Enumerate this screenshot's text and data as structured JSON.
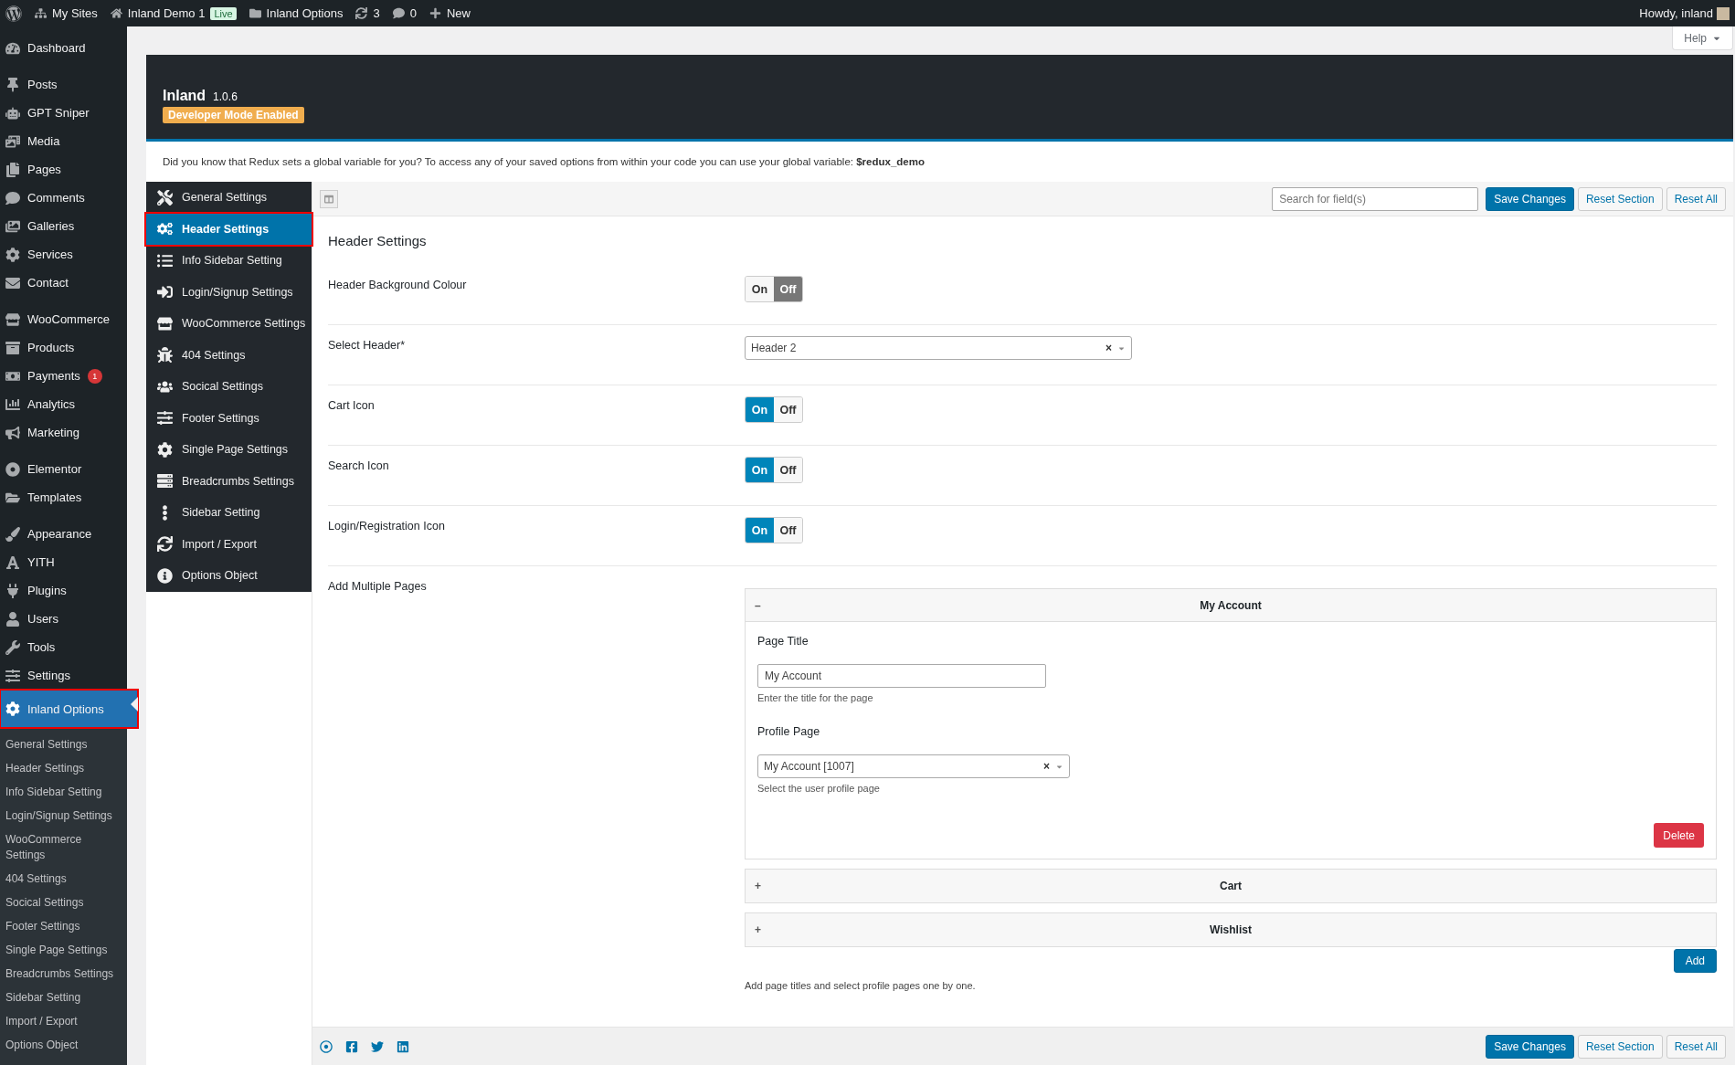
{
  "admin_bar": {
    "items": [
      {
        "kind": "link",
        "label": "My Sites"
      },
      {
        "kind": "link",
        "label": "Inland Demo 1"
      },
      {
        "kind": "badge",
        "label": "Live"
      },
      {
        "kind": "link",
        "label": "Inland Options"
      },
      {
        "kind": "count",
        "label": "3"
      },
      {
        "kind": "count",
        "label": "0"
      },
      {
        "kind": "link",
        "label": "New"
      }
    ],
    "greeting": "Howdy, inland"
  },
  "sidebar": {
    "groups": [
      {
        "items": [
          {
            "label": "Dashboard",
            "selected": false
          }
        ]
      },
      {
        "items": [
          {
            "label": "Posts",
            "selected": false
          },
          {
            "label": "GPT Sniper",
            "selected": false
          },
          {
            "label": "Media",
            "selected": false
          },
          {
            "label": "Pages",
            "selected": false
          },
          {
            "label": "Comments",
            "selected": false
          },
          {
            "label": "Galleries",
            "selected": false
          },
          {
            "label": "Services",
            "selected": false
          },
          {
            "label": "Contact",
            "selected": false
          }
        ]
      },
      {
        "items": [
          {
            "label": "WooCommerce",
            "selected": false
          },
          {
            "label": "Products",
            "selected": false
          },
          {
            "label": "Payments",
            "selected": false,
            "badge": "1"
          },
          {
            "label": "Analytics",
            "selected": false
          },
          {
            "label": "Marketing",
            "selected": false
          }
        ]
      },
      {
        "items": [
          {
            "label": "Elementor",
            "selected": false
          },
          {
            "label": "Templates",
            "selected": false
          }
        ]
      },
      {
        "items": [
          {
            "label": "Appearance",
            "selected": false
          },
          {
            "label": "YITH",
            "selected": false
          },
          {
            "label": "Plugins",
            "selected": false
          },
          {
            "label": "Users",
            "selected": false
          },
          {
            "label": "Tools",
            "selected": false
          },
          {
            "label": "Settings",
            "selected": false
          },
          {
            "label": "Inland Options",
            "selected": true,
            "annotated": true
          }
        ]
      }
    ],
    "submenu": [
      "General Settings",
      "Header Settings",
      "Info Sidebar Setting",
      "Login/Signup Settings",
      "WooCommerce Settings",
      "404 Settings",
      "Socical Settings",
      "Footer Settings",
      "Single Page Settings",
      "Breadcrumbs Settings",
      "Sidebar Setting",
      "Import / Export",
      "Options Object"
    ]
  },
  "help_button": "Help",
  "panel": {
    "title": "Inland",
    "version": "1.0.6",
    "dev_badge": "Developer Mode Enabled",
    "notice": "Did you know that Redux sets a global variable for you? To access any of your saved options from within your code you can use your global variable: **$redux_demo**",
    "nav": [
      {
        "label": "General Settings",
        "selected": false
      },
      {
        "label": "Header Settings",
        "selected": true,
        "annotated": true
      },
      {
        "label": "Info Sidebar Setting",
        "selected": false
      },
      {
        "label": "Login/Signup Settings",
        "selected": false
      },
      {
        "label": "WooCommerce Settings",
        "selected": false
      },
      {
        "label": "404 Settings",
        "selected": false
      },
      {
        "label": "Socical Settings",
        "selected": false
      },
      {
        "label": "Footer Settings",
        "selected": false
      },
      {
        "label": "Single Page Settings",
        "selected": false
      },
      {
        "label": "Breadcrumbs Settings",
        "selected": false
      },
      {
        "label": "Sidebar Setting",
        "selected": false
      },
      {
        "label": "Import / Export",
        "selected": false
      },
      {
        "label": "Options Object",
        "selected": false
      }
    ],
    "search": {
      "placeholder": "Search for field(s)"
    },
    "buttons": [
      "Save Changes",
      "Reset Section",
      "Reset All"
    ],
    "section_title": "Header Settings",
    "fields": [
      {
        "kind": "switch",
        "label": "Header Background Colour",
        "on": false,
        "on_label": "On",
        "off_label": "Off"
      },
      {
        "kind": "select",
        "label": "Select Header*",
        "value": "Header 2",
        "clear": "×"
      },
      {
        "kind": "switch",
        "label": "Cart Icon",
        "on": true,
        "on_label": "On",
        "off_label": "Off"
      },
      {
        "kind": "switch",
        "label": "Search Icon",
        "on": true,
        "on_label": "On",
        "off_label": "Off"
      },
      {
        "kind": "switch",
        "label": "Login/Registration Icon",
        "on": true,
        "on_label": "On",
        "off_label": "Off"
      },
      {
        "kind": "repeater",
        "label": "Add Multiple Pages",
        "items": [
          {
            "title": "My Account",
            "expanded": true,
            "toggle": "–",
            "page_title_label": "Page Title",
            "page_title": "My Account",
            "page_title_help": "Enter the title for the page",
            "profile_label": "Profile Page",
            "profile": "My Account [1007]",
            "clear": "×",
            "profile_help": "Select the user profile page",
            "delete": "Delete"
          },
          {
            "title": "Cart",
            "expanded": false,
            "toggle": "+"
          },
          {
            "title": "Wishlist",
            "expanded": false,
            "toggle": "+"
          }
        ],
        "add": "Add",
        "help": "Add page titles and select profile pages one by one."
      }
    ],
    "footer_buttons": [
      "Save Changes",
      "Reset Section",
      "Reset All"
    ]
  }
}
